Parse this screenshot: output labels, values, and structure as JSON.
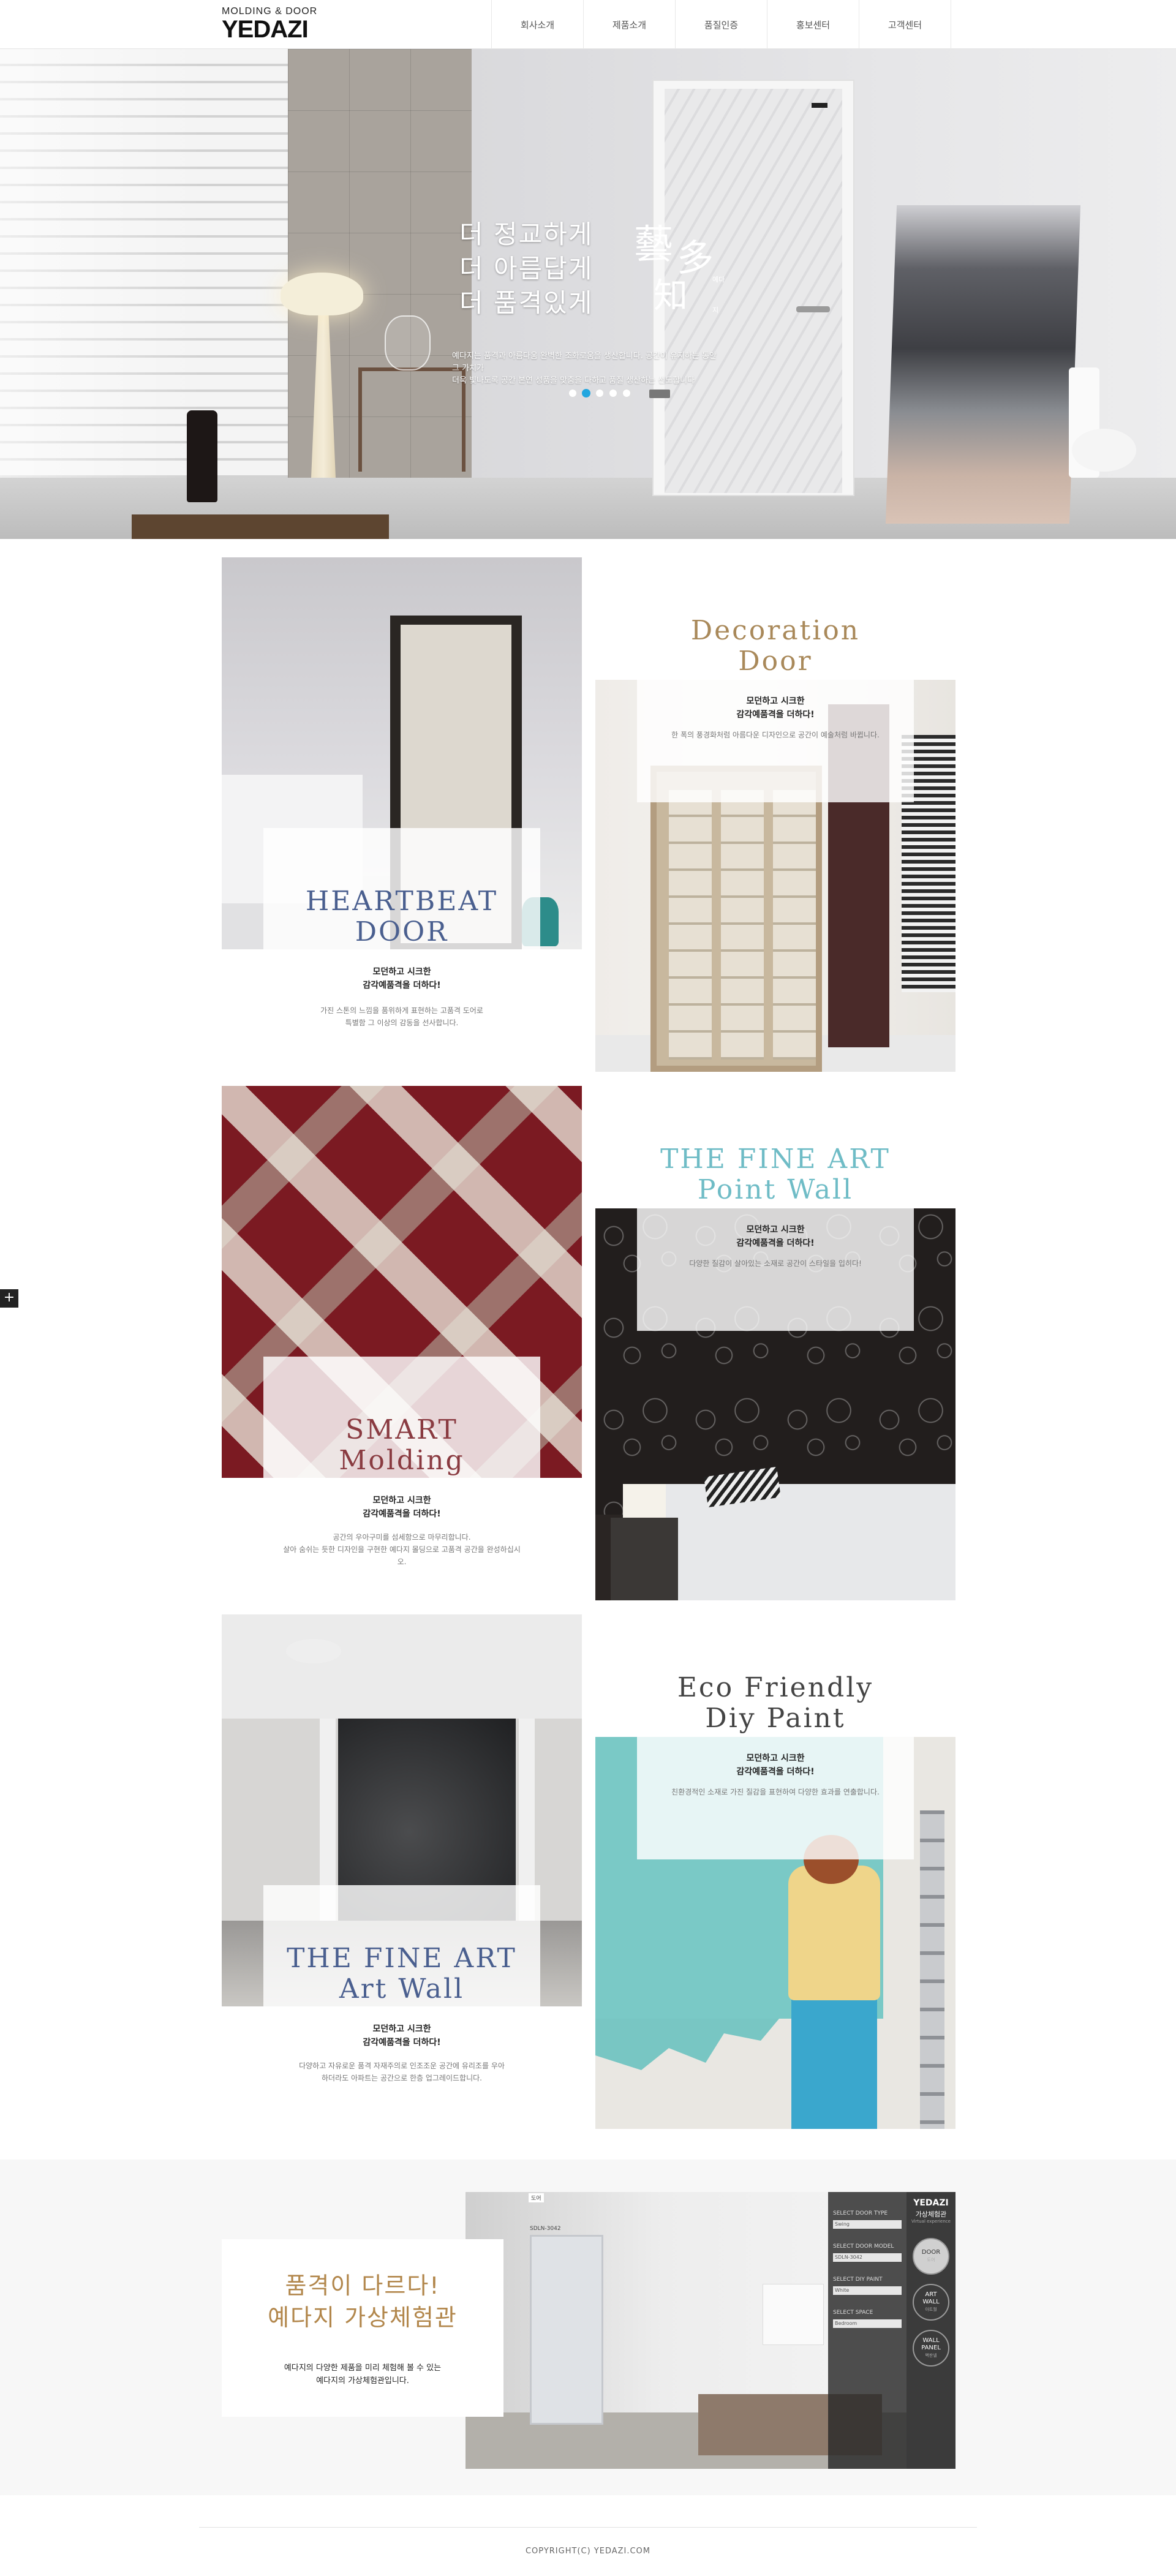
{
  "header": {
    "logo_sub": "MOLDING & DOOR",
    "logo_main": "YEDAZI",
    "nav": [
      "회사소개",
      "제품소개",
      "품질인증",
      "홍보센터",
      "고객센터"
    ]
  },
  "hero": {
    "lines": [
      "더 정교하게",
      "더 아름답게",
      "더 품격있게"
    ],
    "hanja": [
      "藝",
      "多",
      "知"
    ],
    "hanja_readings": [
      "예다",
      "지"
    ],
    "desc_line1": "예다지는 품격과 아름다움 완벽한 조화로움을 생산합니다. 공간이 유지하는 동안 그 가치가",
    "desc_line2": "더욱 빛나도록 공간 본연 성품을 맞춤을 다하고 품질 생산하는 선도합니다",
    "slides": 5,
    "active_slide": 2
  },
  "products": [
    {
      "title_1": "HEARTBEAT",
      "title_2": "DOOR",
      "color": "#4a5f8f",
      "sub_1": "모던하고 시크한",
      "sub_2": "감각예품격을 더하다!",
      "desc_1": "가진 스톤의 느낌을 품위하게 표현하는 고품격 도어로",
      "desc_2": "특별함 그 이상의 감동을 선사합니다."
    },
    {
      "title_1": "Decoration",
      "title_2": "Door",
      "color": "#a9895a",
      "sub_1": "모던하고 시크한",
      "sub_2": "감각예품격을 더하다!",
      "desc_1": "한 폭의 풍경화처럼 아름다운 디자인으로 공간이 예술처럼 바뀝니다.",
      "desc_2": ""
    },
    {
      "title_1": "SMART",
      "title_2": "Molding",
      "color": "#8a3b41",
      "sub_1": "모던하고 시크한",
      "sub_2": "감각예품격을 더하다!",
      "desc_1": "공간의 우아구미를 섬세함으로 마무리합니다.",
      "desc_2": "살아 숨쉬는 듯한 디자인을 구현한 예다지 몰딩으로 고품격 공간을 완성하십시오."
    },
    {
      "title_1": "THE FINE ART",
      "title_2": "Point Wall",
      "color": "#6fbcc6",
      "sub_1": "모던하고 시크한",
      "sub_2": "감각예품격을 더하다!",
      "desc_1": "다양한 질감이 살아있는 소재로 공간이 스타일을 입히다!",
      "desc_2": ""
    },
    {
      "title_1": "THE FINE ART",
      "title_2": "Art Wall",
      "color": "#4a5f8f",
      "sub_1": "모던하고 시크한",
      "sub_2": "감각예품격을 더하다!",
      "desc_1": "다양하고 자유로운 품격 자재주의로 인조조운 공간에 유리조를 우아",
      "desc_2": "하더라도 아파트는 공간으로 한층 업그레이드합니다."
    },
    {
      "title_1": "Eco Friendly",
      "title_2": "Diy Paint",
      "color": "#444444",
      "sub_1": "모던하고 시크한",
      "sub_2": "감각예품격을 더하다!",
      "desc_1": "친환경적인 소재로 가진 질감을 표현하여 다양한 효과를 연출합니다.",
      "desc_2": ""
    }
  ],
  "virtual": {
    "title_1": "품격이 다르다!",
    "title_2": "예다지 가상체험관",
    "desc_1": "예다지의 다양한 제품을 미리 체험해 볼 수 있는",
    "desc_2": "예다지의 가상체험관입니다.",
    "sidebar_labels": [
      "SELECT DOOR TYPE",
      "SELECT DOOR MODEL",
      "SELECT DIY PAINT",
      "SELECT SPACE"
    ],
    "sidebar_fields": [
      "Swing",
      "SDLN-3042",
      "White",
      "Bedroom"
    ],
    "panel_brand": "YEDAZI",
    "panel_title": "가상체험관",
    "panel_caption": "Virtual experience",
    "panel_buttons": [
      {
        "label_1": "DOOR",
        "label_2": "",
        "sub": "도어"
      },
      {
        "label_1": "ART",
        "label_2": "WALL",
        "sub": "아트월"
      },
      {
        "label_1": "WALL",
        "label_2": "PANEL",
        "sub": "벽판넬"
      }
    ],
    "room_top_label": "도어",
    "room_door_label": "SDLN-3042"
  },
  "footer": {
    "copyright": "COPYRIGHT(C) YEDAZI.COM"
  }
}
